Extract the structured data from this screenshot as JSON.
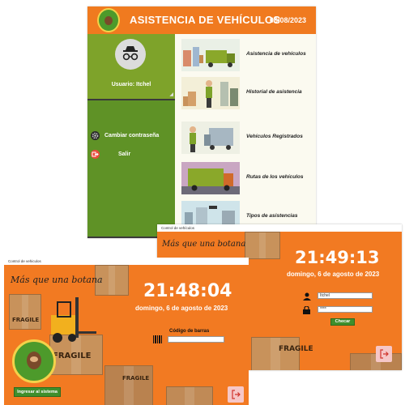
{
  "window1": {
    "title": "ASISTENCIA DE VEHÍCULOS",
    "date": "06/08/2023",
    "logo": {
      "brand_top": "BOTANAS",
      "brand_bottom": "SHERLYN"
    },
    "user_label": "Usuario: Itchel",
    "menu": [
      {
        "label": "Cambiar contraseña",
        "icon": "gear-icon"
      },
      {
        "label": "Salir",
        "icon": "exit-icon"
      }
    ],
    "rows": [
      {
        "label": "Asistencia de vehículos"
      },
      {
        "label": "Historial de asistencia"
      },
      {
        "label": "Vehículos Registrados"
      },
      {
        "label": "Rutas de los vehículos"
      },
      {
        "label": "Tipos de asistencias"
      }
    ]
  },
  "window2": {
    "titlebar": "Control de vehiculos",
    "slogan": "Más que una botana",
    "time": "21:48:04",
    "date": "domingo, 6 de agosto de 2023",
    "barcode_label": "Código de barras",
    "barcode_value": "",
    "fragile": "FRAGILE",
    "logo": {
      "brand_top": "BOTANAS",
      "brand_bottom": "SHERLYN"
    },
    "enter_button": "Ingresar al sistema"
  },
  "window3": {
    "titlebar": "Control de vehículos",
    "slogan": "Más que una botana",
    "time": "21:49:13",
    "date": "domingo, 6 de agosto de 2023",
    "user_value": "Itchel",
    "password_value": "****",
    "check_button": "Checar",
    "fragile": "FRAGILE"
  }
}
